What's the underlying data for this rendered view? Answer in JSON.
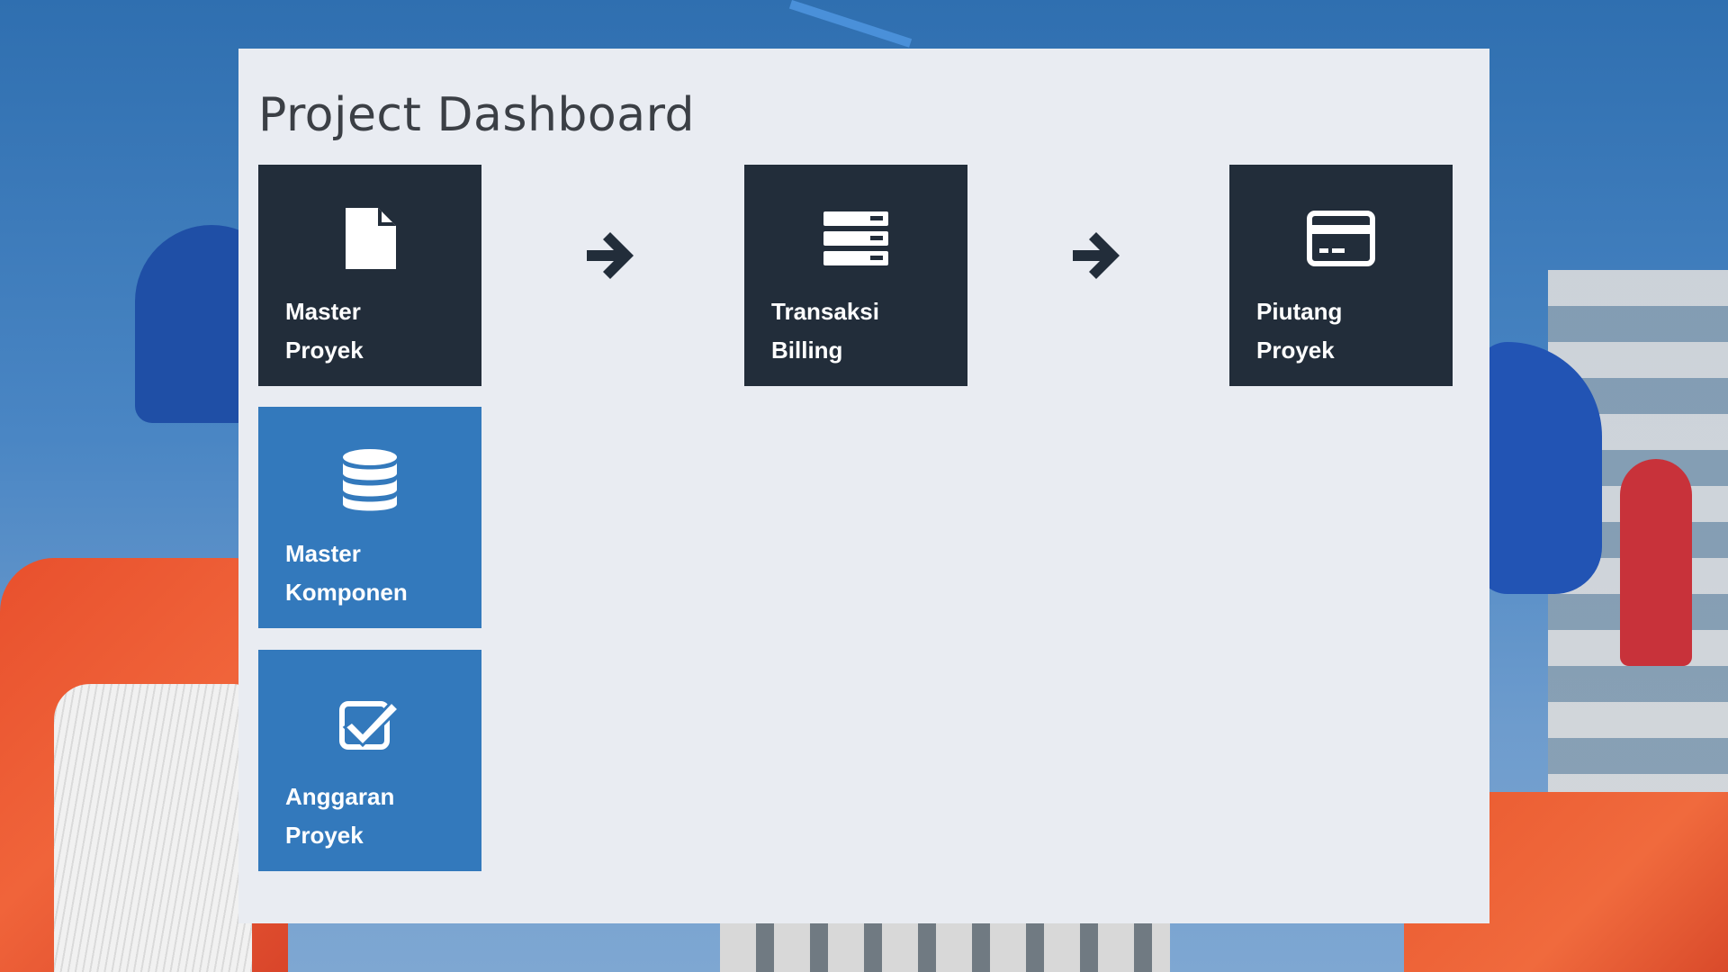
{
  "page": {
    "title": "Project Dashboard"
  },
  "tiles": [
    {
      "id": "master-proyek",
      "line1": "Master",
      "line2": "Proyek",
      "icon": "file-icon",
      "color": "#222d3a"
    },
    {
      "id": "transaksi-billing",
      "line1": "Transaksi",
      "line2": "Billing",
      "icon": "server-icon",
      "color": "#222d3a"
    },
    {
      "id": "piutang-proyek",
      "line1": "Piutang",
      "line2": "Proyek",
      "icon": "credit-card-icon",
      "color": "#222d3a"
    },
    {
      "id": "master-komponen",
      "line1": "Master",
      "line2": "Komponen",
      "icon": "database-icon",
      "color": "#3379bc"
    },
    {
      "id": "anggaran-proyek",
      "line1": "Anggaran",
      "line2": "Proyek",
      "icon": "checkbox-icon",
      "color": "#3379bc"
    }
  ],
  "arrows": [
    "arrow-right-icon",
    "arrow-right-icon"
  ],
  "colors": {
    "panel_background": "#e9ecf2",
    "tile_dark": "#222d3a",
    "tile_blue": "#3379bc",
    "title_text": "#3b3f45",
    "arrow": "#222d3a"
  }
}
